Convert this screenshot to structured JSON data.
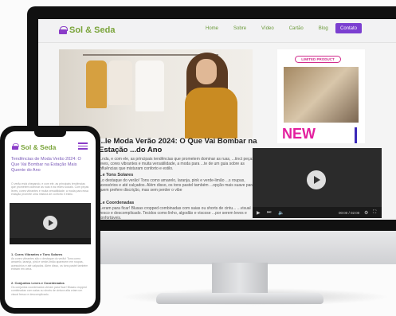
{
  "desktop": {
    "logo": "Sol & Seda",
    "nav": [
      "Home",
      "Sobre",
      "Vídeo",
      "Cartão",
      "Blog"
    ],
    "contact": "Contato",
    "title": "...le Moda Verão 2024: O Que Vai Bombar na Estação ...do Ano",
    "intro": "...nda, e com ele, as principais tendências que prometem dominar as ruas, ...tinct peças leves, cores vibrantes e muita versatilidade, a moda para ...te de um guia sobre as influências que misturam conforto e estilo.",
    "section1_heading": "...e Tons Solares",
    "section1_text": "...o destaque do verão! Tons como amarelo, laranja, pink e verde-limão ...s roupas, acessórios e até calçados. Além disso, os tons pastel também ...opção mais suave para quem prefere discrição, mas sem perder o vibe",
    "section2_heading": "...e Coordenadas",
    "section2_text": "...eram para ficar! Blusas cropped combinadas com saias ou shorts de cintu... ...visual fresco e descomplicado. Tecidos como linho, algodão e viscose ...por serem leves e confortáveis.",
    "ad_badge": "LIMITED PRODUCT",
    "ad_word": "NEW",
    "video_time": "00:00 / 02:00"
  },
  "phone": {
    "logo": "Sol & Seda",
    "title": "Tendências de Moda Verão 2024: O Que Vai Bombar na Estação Mais Quente do Ano",
    "intro": "O verão está chegando, e com ele, as principais tendências que prometem dominar as ruas e as redes sociais. Com peças leves, cores vibrantes e muita versatilidade, a moda para essa estação promete uma mistura de conforto e estilo.",
    "item1_heading": "1. Cores Vibrantes e Tons Solares",
    "item1_text": "As cores vibrantes são o destaque do verão! Tons como amarelo, laranja, pink e verde-limão aparecem em roupas, acessórios e até calçados. Além disso, os tons pastel também entram em cena.",
    "item2_heading": "2. Conjuntos Leves e Coordenados",
    "item2_text": "Os conjuntos coordenados vieram para ficar! Blusas cropped combinadas com saias ou shorts de cintura alta criam um visual fresco e descomplicado."
  },
  "colors": {
    "brand_green": "#7aa43a",
    "brand_purple": "#7b3fd0",
    "ad_pink": "#e31f9e"
  }
}
